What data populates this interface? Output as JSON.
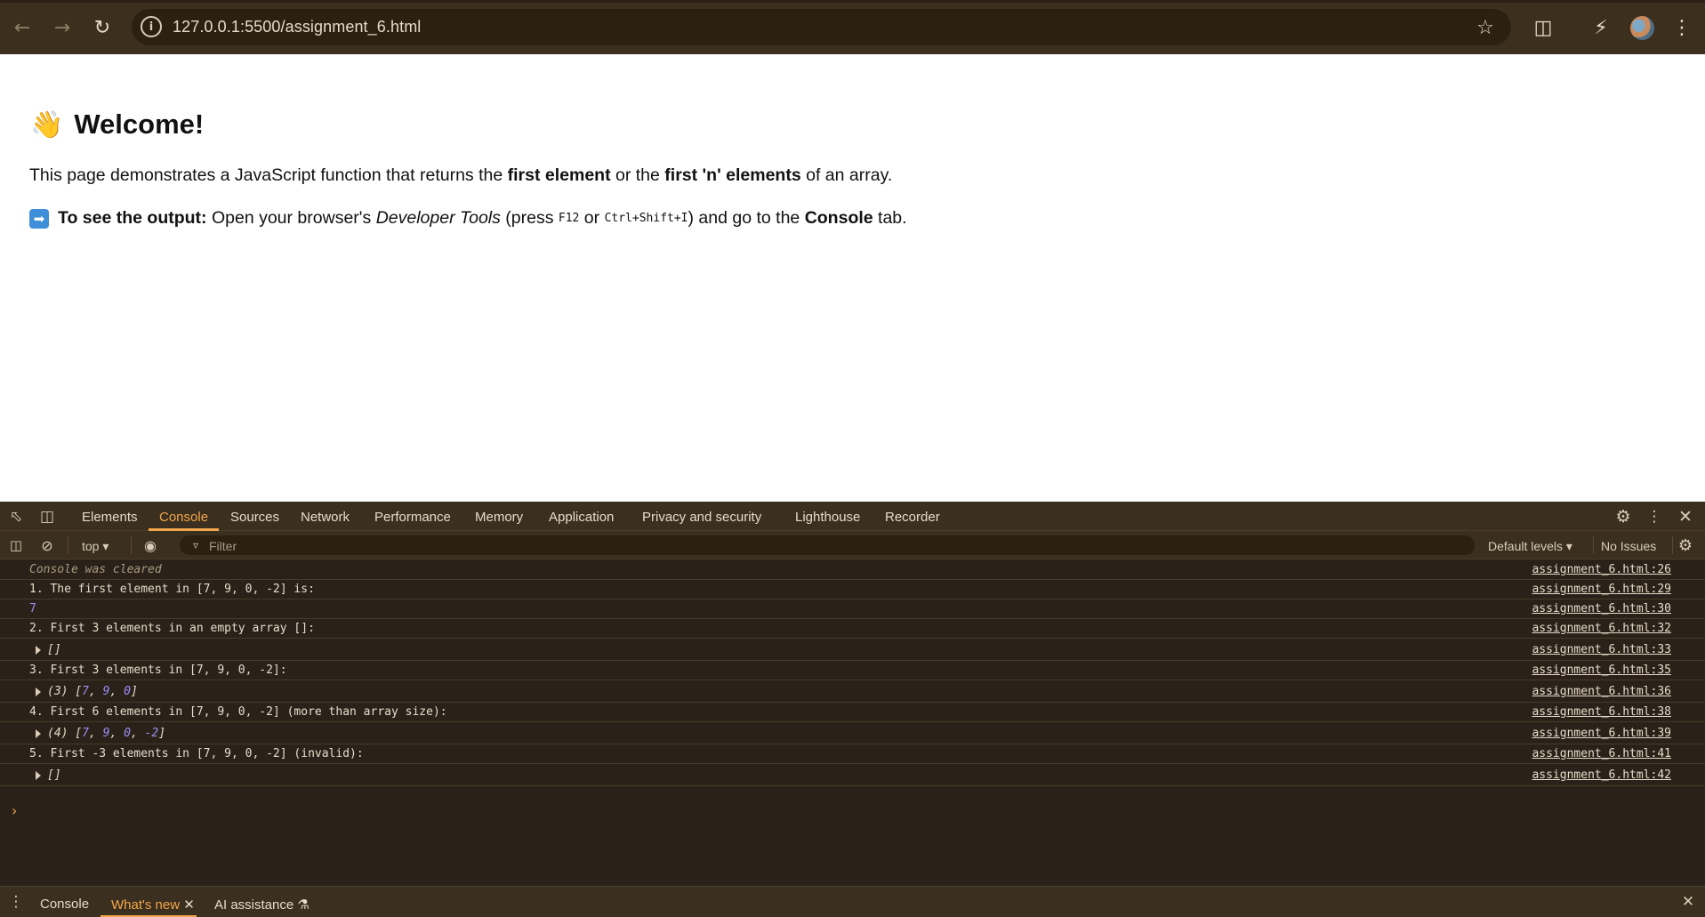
{
  "browser": {
    "url": "127.0.0.1:5500/assignment_6.html",
    "icons": [
      "back-arrow-icon",
      "forward-arrow-icon",
      "reload-icon",
      "site-info-icon",
      "bookmark-star-icon",
      "extensions-icon",
      "performance-icon",
      "profile-avatar",
      "browser-menu-icon"
    ]
  },
  "page": {
    "title": "Welcome!",
    "emoji": "👋",
    "intro": {
      "prefix": "This page demonstrates a JavaScript function that returns the ",
      "bold1": "first element",
      "mid": " or the ",
      "bold2": "first 'n' elements",
      "suffix": " of an array."
    },
    "instruction": {
      "arrow": "➡",
      "label": "To see the output:",
      "text1": " Open your browser's ",
      "italic": "Developer Tools",
      "text2": " (press ",
      "key1": "F12",
      "text3": " or ",
      "key2": "Ctrl+Shift+I",
      "text4": ") and go to the ",
      "bold": "Console",
      "text5": " tab."
    }
  },
  "devtools": {
    "tabs": [
      "Elements",
      "Console",
      "Sources",
      "Network",
      "Performance",
      "Memory",
      "Application",
      "Privacy and security",
      "Lighthouse",
      "Recorder"
    ],
    "active_tab": "Console",
    "toolbar": {
      "context": "top ▾",
      "filter_placeholder": "Filter",
      "levels": "Default levels ▾",
      "issues": "No Issues"
    },
    "console_rows": [
      {
        "text": "Console was cleared",
        "source": "assignment_6.html:26",
        "kind": "cleared"
      },
      {
        "text": "1. The first element in [7, 9, 0, -2] is:",
        "source": "assignment_6.html:29",
        "kind": "log"
      },
      {
        "text": "7",
        "source": "assignment_6.html:30",
        "kind": "number"
      },
      {
        "text": "2. First 3 elements in an empty array []:",
        "source": "assignment_6.html:32",
        "kind": "log"
      },
      {
        "text": "[]",
        "source": "assignment_6.html:33",
        "kind": "array"
      },
      {
        "text": "3. First 3 elements in [7, 9, 0, -2]:",
        "source": "assignment_6.html:35",
        "kind": "log"
      },
      {
        "text": "(3) [7, 9, 0]",
        "source": "assignment_6.html:36",
        "kind": "array"
      },
      {
        "text": "4. First 6 elements in [7, 9, 0, -2] (more than array size):",
        "source": "assignment_6.html:38",
        "kind": "log"
      },
      {
        "text": "(4) [7, 9, 0, -2]",
        "source": "assignment_6.html:39",
        "kind": "array"
      },
      {
        "text": "5. First -3 elements in [7, 9, 0, -2] (invalid):",
        "source": "assignment_6.html:41",
        "kind": "log"
      },
      {
        "text": "[]",
        "source": "assignment_6.html:42",
        "kind": "array"
      }
    ],
    "prompt": "›",
    "drawer": {
      "tabs": [
        "Console",
        "What's new",
        "AI assistance"
      ],
      "active": "What's new"
    }
  },
  "colors": {
    "chrome_bg": "#3c2f1d",
    "devtools_bg": "#2a2218",
    "accent": "#f2a64a",
    "number": "#9d8cf5"
  }
}
